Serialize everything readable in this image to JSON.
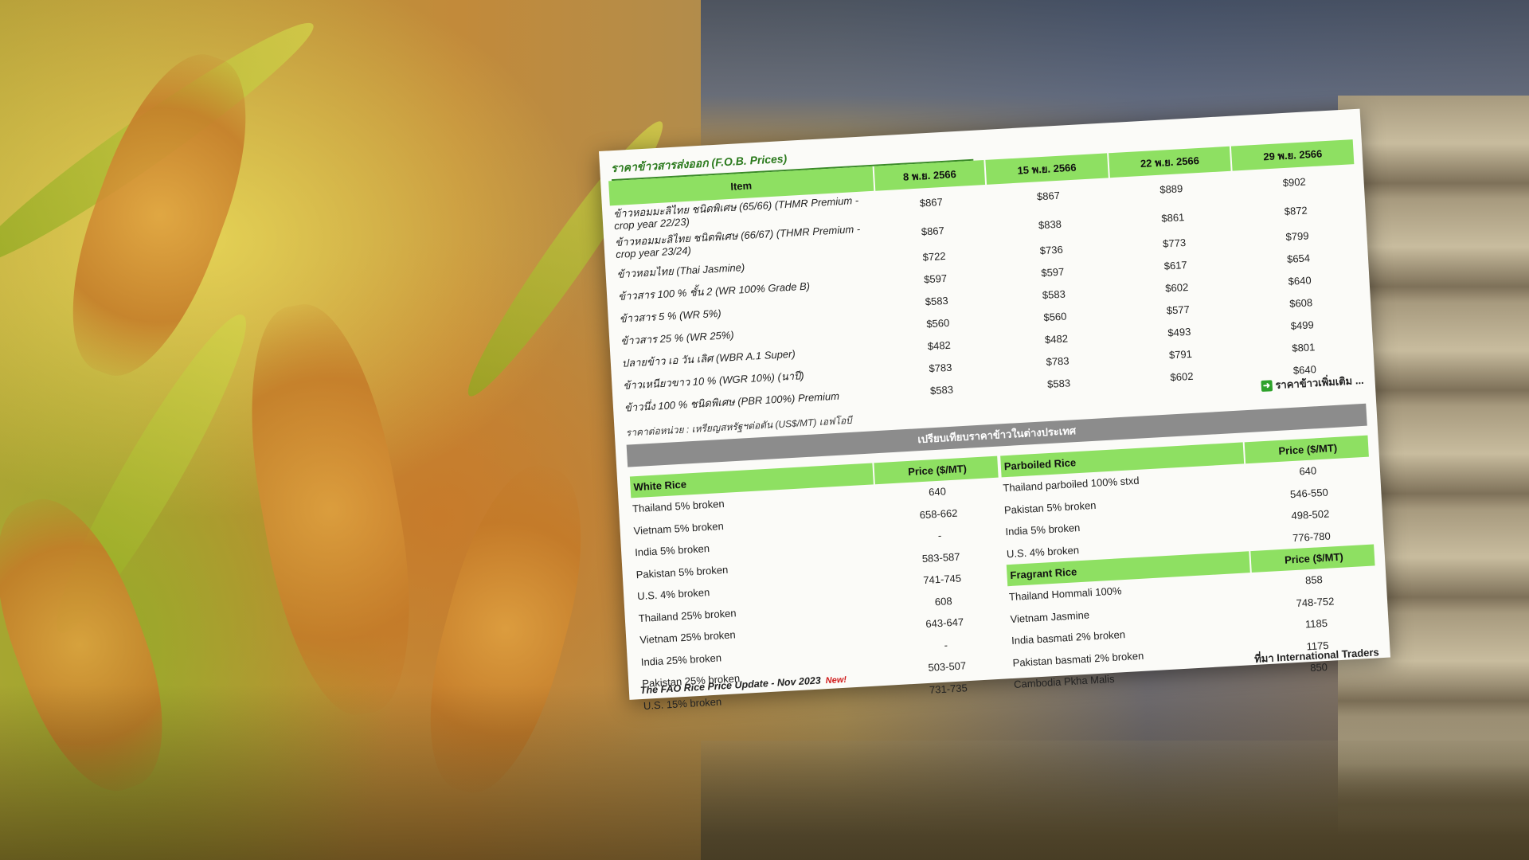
{
  "fob": {
    "title": "ราคาข้าวสารส่งออก (F.O.B. Prices)",
    "headers": [
      "Item",
      "8 พ.ย. 2566",
      "15 พ.ย. 2566",
      "22 พ.ย. 2566",
      "29 พ.ย. 2566"
    ],
    "rows": [
      {
        "item": "ข้าวหอมมะลิไทย ชนิดพิเศษ (65/66) (THMR Premium - crop year 22/23)",
        "v": [
          "$867",
          "$867",
          "$889",
          "$902"
        ]
      },
      {
        "item": "ข้าวหอมมะลิไทย ชนิดพิเศษ (66/67) (THMR Premium - crop year 23/24)",
        "v": [
          "$867",
          "$838",
          "$861",
          "$872"
        ]
      },
      {
        "item": "ข้าวหอมไทย (Thai Jasmine)",
        "v": [
          "$722",
          "$736",
          "$773",
          "$799"
        ]
      },
      {
        "item": "ข้าวสาร 100 % ชั้น 2 (WR 100% Grade B)",
        "v": [
          "$597",
          "$597",
          "$617",
          "$654"
        ]
      },
      {
        "item": "ข้าวสาร 5 % (WR 5%)",
        "v": [
          "$583",
          "$583",
          "$602",
          "$640"
        ]
      },
      {
        "item": "ข้าวสาร 25 % (WR 25%)",
        "v": [
          "$560",
          "$560",
          "$577",
          "$608"
        ]
      },
      {
        "item": "ปลายข้าว เอ วัน เลิศ (WBR A.1 Super)",
        "v": [
          "$482",
          "$482",
          "$493",
          "$499"
        ]
      },
      {
        "item": "ข้าวเหนียวขาว 10 % (WGR 10%) (นาปี)",
        "v": [
          "$783",
          "$783",
          "$791",
          "$801"
        ]
      },
      {
        "item": "ข้าวนึ่ง 100 % ชนิดพิเศษ (PBR 100%) Premium",
        "v": [
          "$583",
          "$583",
          "$602",
          "$640"
        ]
      }
    ],
    "unit_note": "ราคาต่อหน่วย : เหรียญสหรัฐฯต่อตัน (US$/MT) เอฟโอบี",
    "more_link": "ราคาข้าวเพิ่มเติม ..."
  },
  "compare": {
    "title": "เปรียบเทียบราคาข้าวในต่างประเทศ",
    "white": {
      "header": "White Rice",
      "price_header": "Price ($/MT)",
      "rows": [
        {
          "name": "Thailand 5% broken",
          "price": "640"
        },
        {
          "name": "Vietnam 5% broken",
          "price": "658-662"
        },
        {
          "name": "India 5% broken",
          "price": "-"
        },
        {
          "name": "Pakistan 5% broken",
          "price": "583-587"
        },
        {
          "name": "U.S. 4% broken",
          "price": "741-745"
        },
        {
          "name": "Thailand 25% broken",
          "price": "608"
        },
        {
          "name": "Vietnam 25% broken",
          "price": "643-647"
        },
        {
          "name": "India 25% broken",
          "price": "-"
        },
        {
          "name": "Pakistan 25% broken",
          "price": "503-507"
        },
        {
          "name": "U.S. 15% broken",
          "price": "731-735"
        }
      ]
    },
    "parboiled": {
      "header": "Parboiled Rice",
      "price_header": "Price ($/MT)",
      "rows": [
        {
          "name": "Thailand parboiled 100% stxd",
          "price": "640"
        },
        {
          "name": "Pakistan 5% broken",
          "price": "546-550"
        },
        {
          "name": "India 5% broken",
          "price": "498-502"
        },
        {
          "name": "U.S. 4% broken",
          "price": "776-780"
        }
      ]
    },
    "fragrant": {
      "header": "Fragrant Rice",
      "price_header": "Price ($/MT)",
      "rows": [
        {
          "name": "Thailand Hommali 100%",
          "price": "858"
        },
        {
          "name": "Vietnam Jasmine",
          "price": "748-752"
        },
        {
          "name": "India basmati 2% broken",
          "price": "1185"
        },
        {
          "name": "Pakistan basmati 2% broken",
          "price": "1175"
        },
        {
          "name": "Cambodia Pkha Malis",
          "price": "850"
        }
      ]
    }
  },
  "footer": {
    "fao_link": "The FAO Rice Price Update - Nov 2023",
    "new_badge": "New!",
    "source": "ที่มา International Traders"
  },
  "colors": {
    "header_green": "#8ee062",
    "title_green": "#2b7a1d",
    "bar_grey": "#8c8c8c",
    "new_red": "#d01818"
  }
}
